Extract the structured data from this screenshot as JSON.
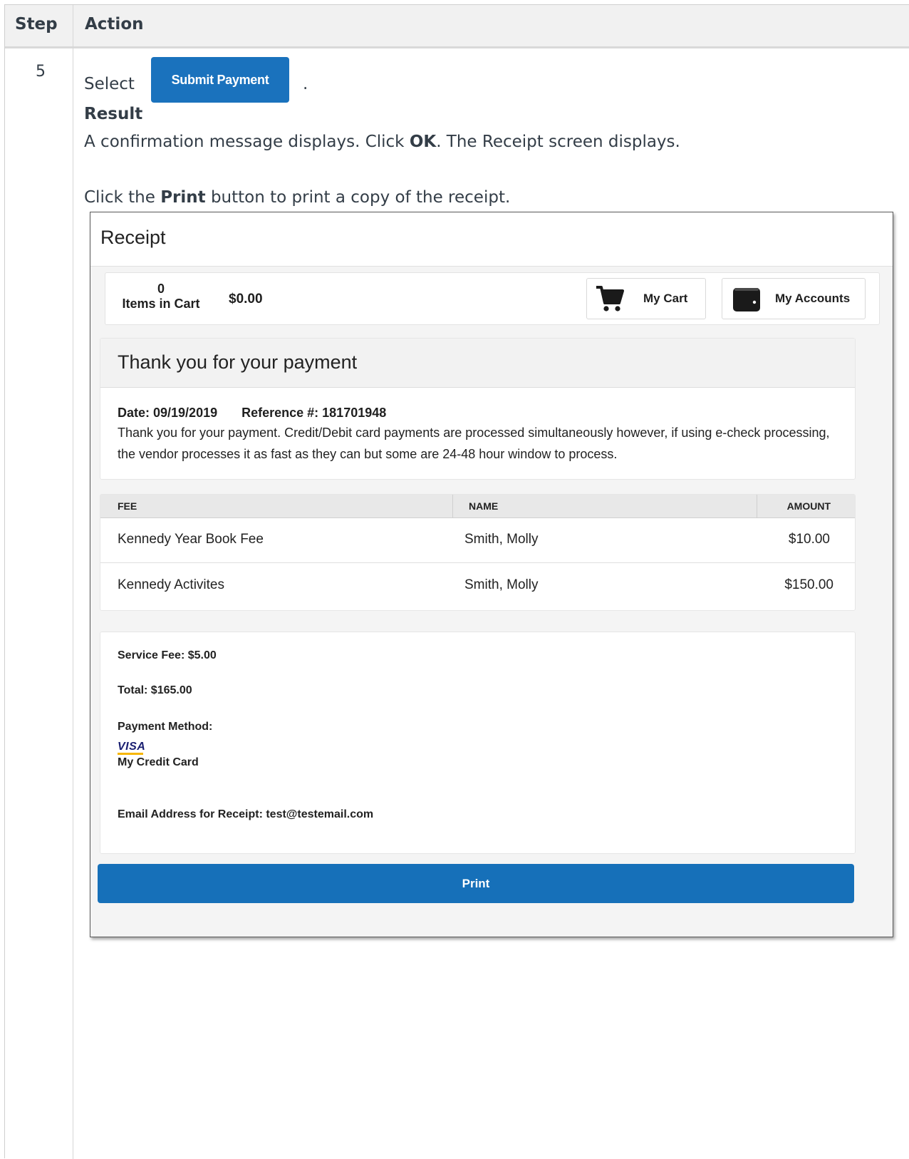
{
  "doc": {
    "header_step": "Step",
    "header_action": "Action",
    "step_number": "5",
    "select_word": "Select",
    "submit_button_label": "Submit Payment",
    "select_period": ".",
    "result_label": "Result",
    "line1_a": "A confirmation message displays. Click ",
    "line1_b": "OK",
    "line1_c": ". The Receipt screen displays.",
    "line2_a": "Click the ",
    "line2_b": "Print",
    "line2_c": " button to print a copy of the receipt."
  },
  "receipt": {
    "title": "Receipt",
    "cart": {
      "count": "0",
      "count_label": "Items in Cart",
      "total": "$0.00",
      "my_cart_label": "My Cart",
      "my_accounts_label": "My Accounts"
    },
    "thanks": {
      "title": "Thank you for your payment",
      "date": "Date: 09/19/2019",
      "reference": "Reference #: 181701948",
      "message": "Thank you for your payment.  Credit/Debit card payments are processed simultaneously however, if using e-check processing, the vendor processes it as fast as they can but some are 24-48 hour window to process."
    },
    "fees": {
      "columns": [
        "FEE",
        "NAME",
        "AMOUNT"
      ],
      "rows": [
        {
          "fee": "Kennedy Year Book Fee",
          "name": "Smith, Molly",
          "amount": "$10.00"
        },
        {
          "fee": "Kennedy Activites",
          "name": "Smith, Molly",
          "amount": "$150.00"
        }
      ]
    },
    "summary": {
      "service_fee": "Service Fee: $5.00",
      "total": "Total: $165.00",
      "payment_method_label": "Payment Method:",
      "card_brand": "VISA",
      "card_name": "My Credit Card",
      "email": "Email Address for Receipt: test@testemail.com"
    },
    "print_label": "Print"
  },
  "colors": {
    "primary_blue": "#1670b9",
    "visa_blue": "#1a1f71",
    "visa_gold": "#f7b600"
  },
  "icons": {
    "cart": "cart-icon",
    "wallet": "wallet-icon"
  }
}
